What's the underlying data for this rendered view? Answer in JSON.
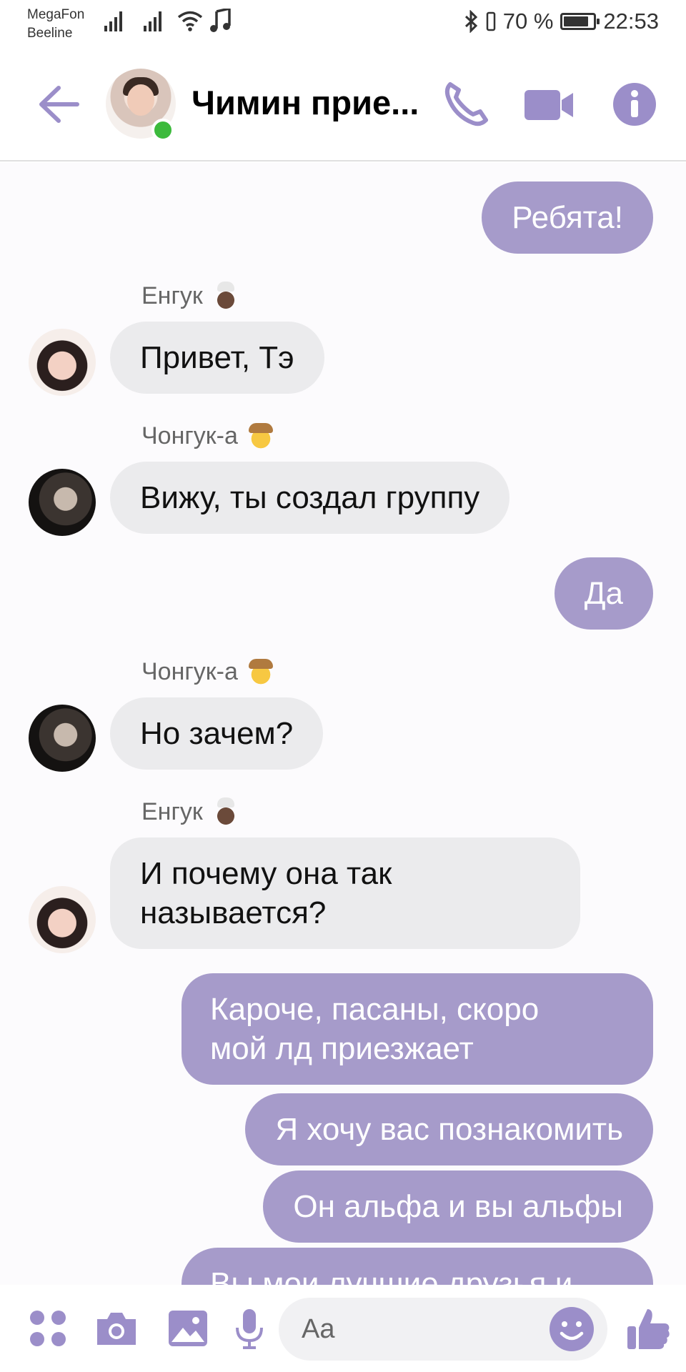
{
  "status_bar": {
    "carrier1": "MegaFon",
    "carrier2": "Beeline",
    "battery": "70 %",
    "time": "22:53"
  },
  "header": {
    "title": "Чимин прие...",
    "accent": "#9b8ec9",
    "online_color": "#3cba3c"
  },
  "messages": [
    {
      "dir": "out",
      "text": "Ребята!"
    },
    {
      "dir": "in",
      "sender": "Енгук",
      "sender_emoji": "chef-emoji",
      "text": "Привет, Тэ"
    },
    {
      "dir": "in",
      "sender": "Чонгук-а",
      "sender_emoji": "cowboy-emoji",
      "text": "Вижу, ты создал группу"
    },
    {
      "dir": "out",
      "text": "Да"
    },
    {
      "dir": "in",
      "sender": "Чонгук-а",
      "sender_emoji": "cowboy-emoji",
      "text": "Но зачем?"
    },
    {
      "dir": "in",
      "sender": "Енгук",
      "sender_emoji": "chef-emoji",
      "line1": "И почему она так",
      "line2": "называется?"
    },
    {
      "dir": "out",
      "line1": "Кароче, пасаны, скоро",
      "line2": "мой лд приезжает"
    },
    {
      "dir": "out",
      "text": "Я хочу вас познакомить"
    },
    {
      "dir": "out",
      "text": "Он альфа и вы альфы"
    },
    {
      "dir": "out",
      "text": "Вы мои лучшие друзья и"
    }
  ],
  "colors": {
    "outgoing_bubble": "#a69bca",
    "incoming_bubble": "#ebebed"
  },
  "composer": {
    "placeholder": "Aa"
  }
}
